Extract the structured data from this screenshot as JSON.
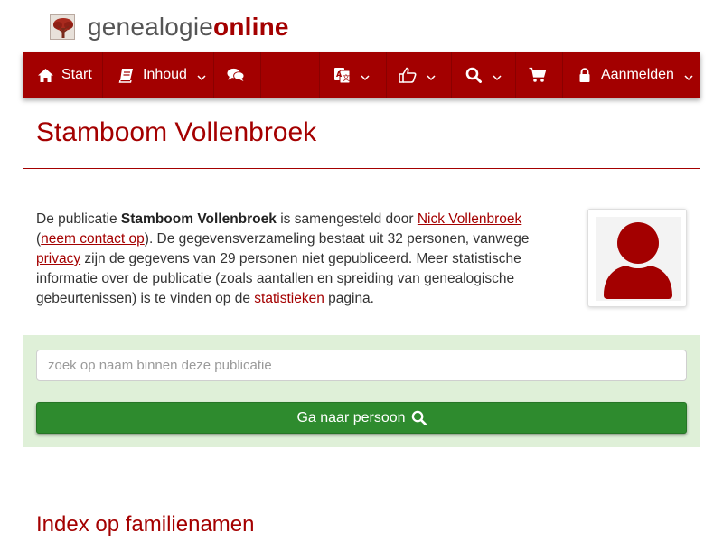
{
  "logo": {
    "text_part1": "genealogie",
    "text_part2": "online",
    "icon": "tree-icon"
  },
  "navbar": {
    "start_label": "Start",
    "inhoud_label": "Inhoud",
    "aanmelden_label": "Aanmelden",
    "icons": [
      "home-icon",
      "book-icon",
      "comments-icon",
      "language-icon",
      "thumbs-up-icon",
      "search-icon",
      "cart-icon",
      "lock-icon"
    ]
  },
  "page": {
    "title": "Stamboom Vollenbroek",
    "index_title": "Index op familienamen"
  },
  "intro": {
    "p1": "De publicatie ",
    "pub_name": "Stamboom Vollenbroek",
    "p2": " is samengesteld door ",
    "author_link": "Nick Vollenbroek",
    "p3": " (",
    "contact_link": "neem contact op",
    "p4": "). De gegevensverzameling bestaat uit 32 personen, vanwege ",
    "privacy_link": "privacy",
    "p5": " zijn de gegevens van 29 personen niet gepubliceerd. Meer statistische informatie over de publicatie (zoals aantallen en spreiding van genealogische gebeurtenissen) is te vinden op de ",
    "stats_link": "statistieken",
    "p6": " pagina."
  },
  "search": {
    "placeholder": "zoek op naam binnen deze publicatie",
    "button_label": "Ga naar persoon"
  },
  "colors": {
    "brand_red": "#a30000",
    "panel_green": "#dff0d8",
    "button_green": "#2e8b2e"
  }
}
